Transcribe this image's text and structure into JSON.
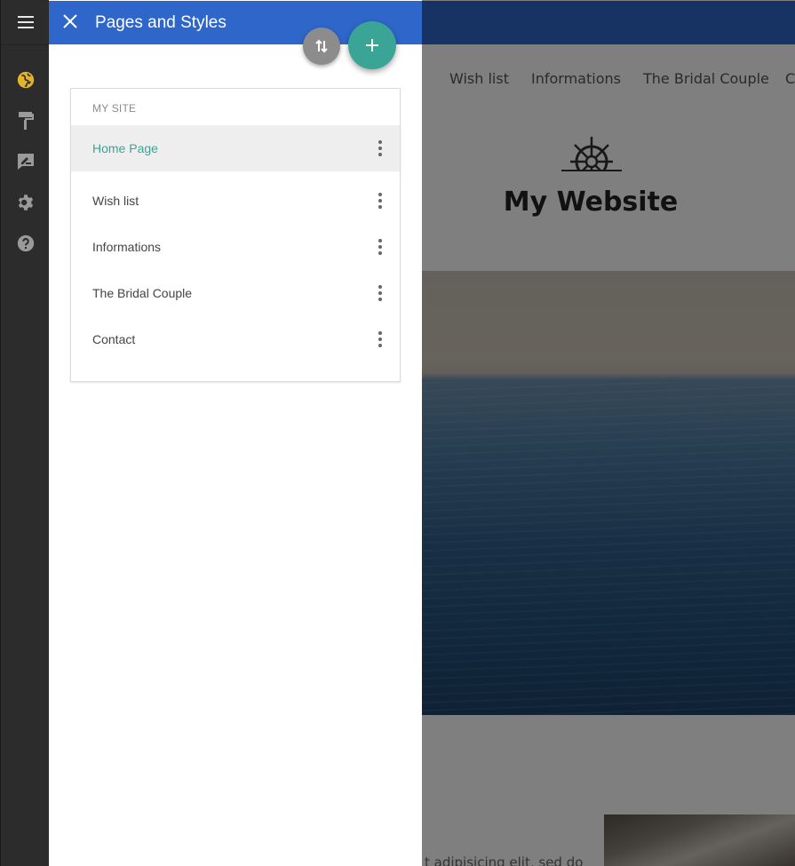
{
  "rail": {
    "items": [
      {
        "icon": "menu-icon",
        "color": "#e6e6e6"
      },
      {
        "icon": "globe-icon",
        "color": "#e3b42a"
      },
      {
        "icon": "paint-roller-icon",
        "color": "#9a9a9a"
      },
      {
        "icon": "edit-note-icon",
        "color": "#9a9a9a"
      },
      {
        "icon": "gear-icon",
        "color": "#9a9a9a"
      },
      {
        "icon": "help-icon",
        "color": "#9a9a9a"
      }
    ]
  },
  "panel": {
    "title": "Pages and Styles",
    "header_color": "#2f66c9",
    "accent_color": "#3aa597",
    "card_header": "MY SITE",
    "pages": [
      {
        "label": "Home Page",
        "active": true
      },
      {
        "label": "Wish list",
        "active": false
      },
      {
        "label": "Informations",
        "active": false
      },
      {
        "label": "The Bridal Couple",
        "active": false
      },
      {
        "label": "Contact",
        "active": false
      }
    ]
  },
  "preview": {
    "nav": [
      "Wish list",
      "Informations",
      "The Bridal Couple",
      "C"
    ],
    "site_title": "My Website",
    "body_text": "t adipisicing elit, sed do"
  }
}
